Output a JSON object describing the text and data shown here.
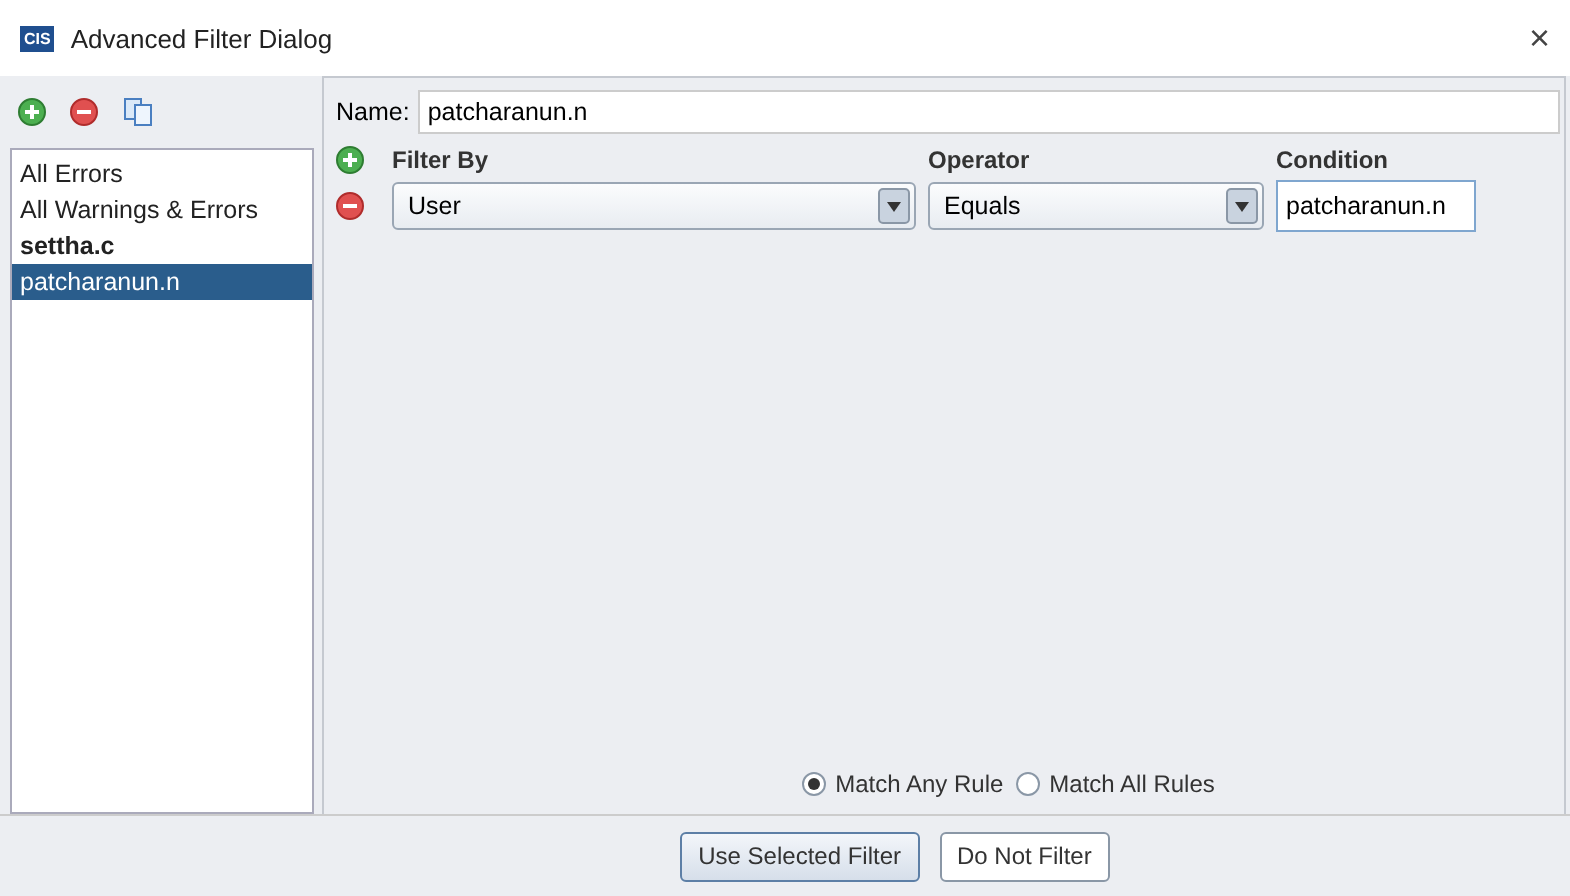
{
  "window": {
    "logo_text": "CIS",
    "title": "Advanced Filter Dialog",
    "close": "×"
  },
  "filters": [
    {
      "label": "All Errors",
      "bold": false,
      "selected": false
    },
    {
      "label": "All Warnings & Errors",
      "bold": false,
      "selected": false
    },
    {
      "label": "settha.c",
      "bold": true,
      "selected": false
    },
    {
      "label": "patcharanun.n",
      "bold": false,
      "selected": true
    }
  ],
  "name_field": {
    "label": "Name:",
    "value": "patcharanun.n"
  },
  "rules": {
    "columns": [
      "Filter By",
      "Operator",
      "Condition"
    ],
    "rows": [
      {
        "filter_by": "User",
        "operator": "Equals",
        "condition": "patcharanun.n"
      }
    ]
  },
  "match": [
    {
      "label": "Match Any Rule",
      "selected": true
    },
    {
      "label": "Match All Rules",
      "selected": false
    }
  ],
  "buttons": [
    {
      "label": "Use Selected Filter",
      "default": true
    },
    {
      "label": "Do Not Filter",
      "default": false
    }
  ]
}
